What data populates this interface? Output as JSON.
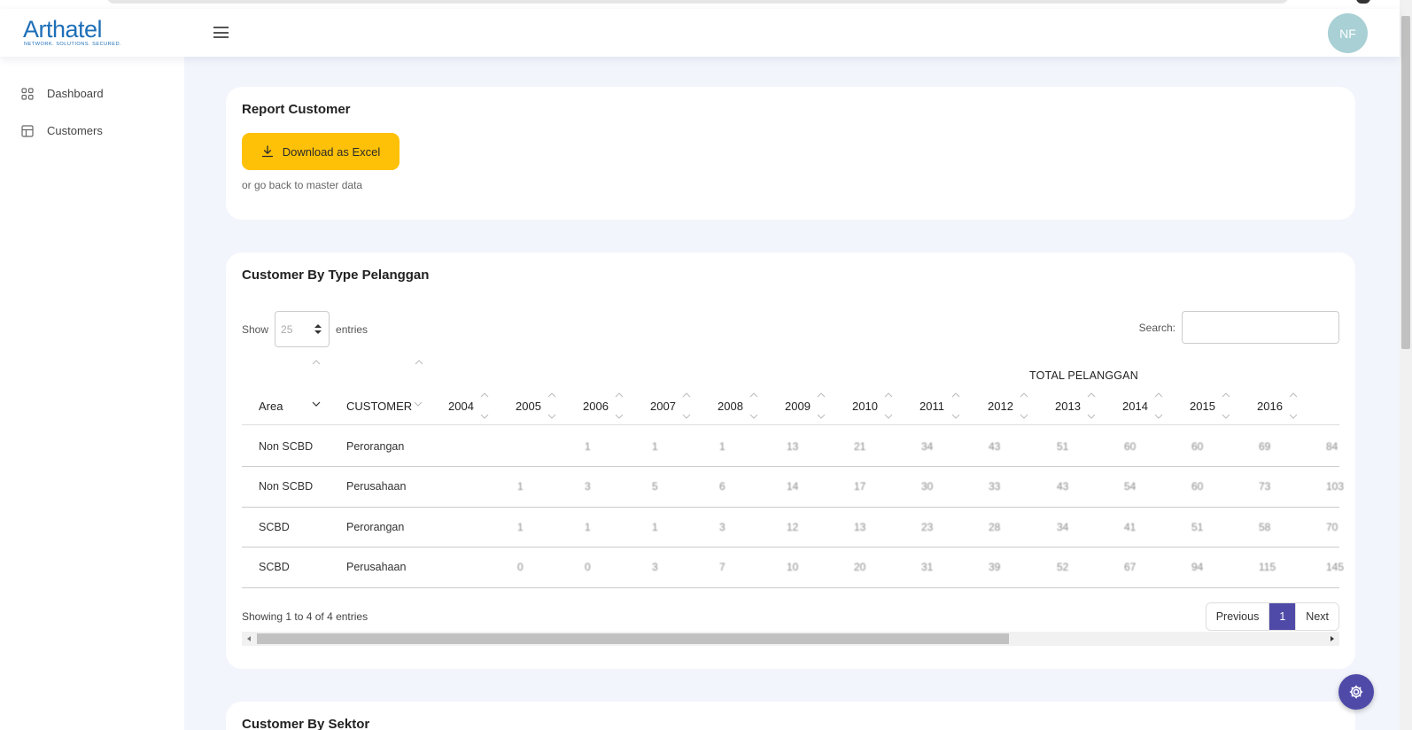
{
  "brand": {
    "name": "Arthatel",
    "tagline": "NETWORK. SOLUTIONS. SECURED."
  },
  "header": {
    "avatar_initials": "NF"
  },
  "sidebar": {
    "items": [
      {
        "label": "Dashboard",
        "icon": "grid-four-icon"
      },
      {
        "label": "Customers",
        "icon": "table-icon"
      }
    ]
  },
  "report_card": {
    "title": "Report Customer",
    "download_label": "Download as Excel",
    "back_text": "or go back to master data"
  },
  "type_card": {
    "title": "Customer By Type Pelanggan",
    "show_label": "Show",
    "entries_label": "entries",
    "page_length": "25",
    "search_label": "Search:",
    "search_value": "",
    "group_header": "TOTAL PELANGGAN",
    "columns": [
      "Area",
      "CUSTOMER",
      "2004",
      "2005",
      "2006",
      "2007",
      "2008",
      "2009",
      "2010",
      "2011",
      "2012",
      "2013",
      "2014",
      "2015",
      "2016"
    ],
    "rows": [
      [
        "Non SCBD",
        "Perorangan",
        "",
        "1",
        "1",
        "1",
        "13",
        "21",
        "34",
        "43",
        "51",
        "60",
        "60",
        "69",
        "84"
      ],
      [
        "Non SCBD",
        "Perusahaan",
        "1",
        "3",
        "5",
        "6",
        "14",
        "17",
        "30",
        "33",
        "43",
        "54",
        "60",
        "73",
        "103"
      ],
      [
        "SCBD",
        "Perorangan",
        "1",
        "1",
        "1",
        "3",
        "12",
        "13",
        "23",
        "28",
        "34",
        "41",
        "51",
        "58",
        "70"
      ],
      [
        "SCBD",
        "Perusahaan",
        "0",
        "0",
        "3",
        "7",
        "10",
        "20",
        "31",
        "39",
        "52",
        "67",
        "94",
        "115",
        "145"
      ]
    ],
    "info_text": "Showing 1 to 4 of 4 entries",
    "pager": {
      "previous": "Previous",
      "current": "1",
      "next": "Next"
    }
  },
  "sektor_card": {
    "title": "Customer By Sektor"
  },
  "colors": {
    "accent": "#4f4aa8",
    "button_yellow": "#fec107",
    "brand_blue": "#1e6fb8",
    "avatar_bg": "#a8d0d5"
  }
}
